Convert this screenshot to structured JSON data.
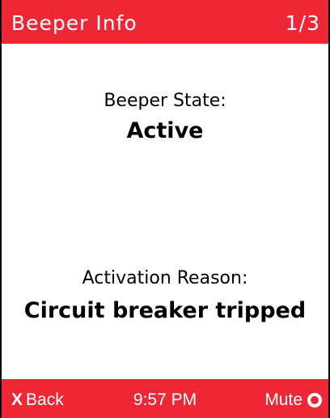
{
  "header": {
    "title": "Beeper Info",
    "page_indicator": "1/3"
  },
  "beeper": {
    "state_label": "Beeper State:",
    "state_value": "Active",
    "reason_label": "Activation Reason:",
    "reason_value": "Circuit breaker tripped"
  },
  "footer": {
    "back_icon": "X",
    "back_label": "Back",
    "time": "9:57 PM",
    "mute_label": "Mute"
  },
  "colors": {
    "accent": "#ee2737",
    "text": "#000000",
    "background": "#ffffff"
  }
}
